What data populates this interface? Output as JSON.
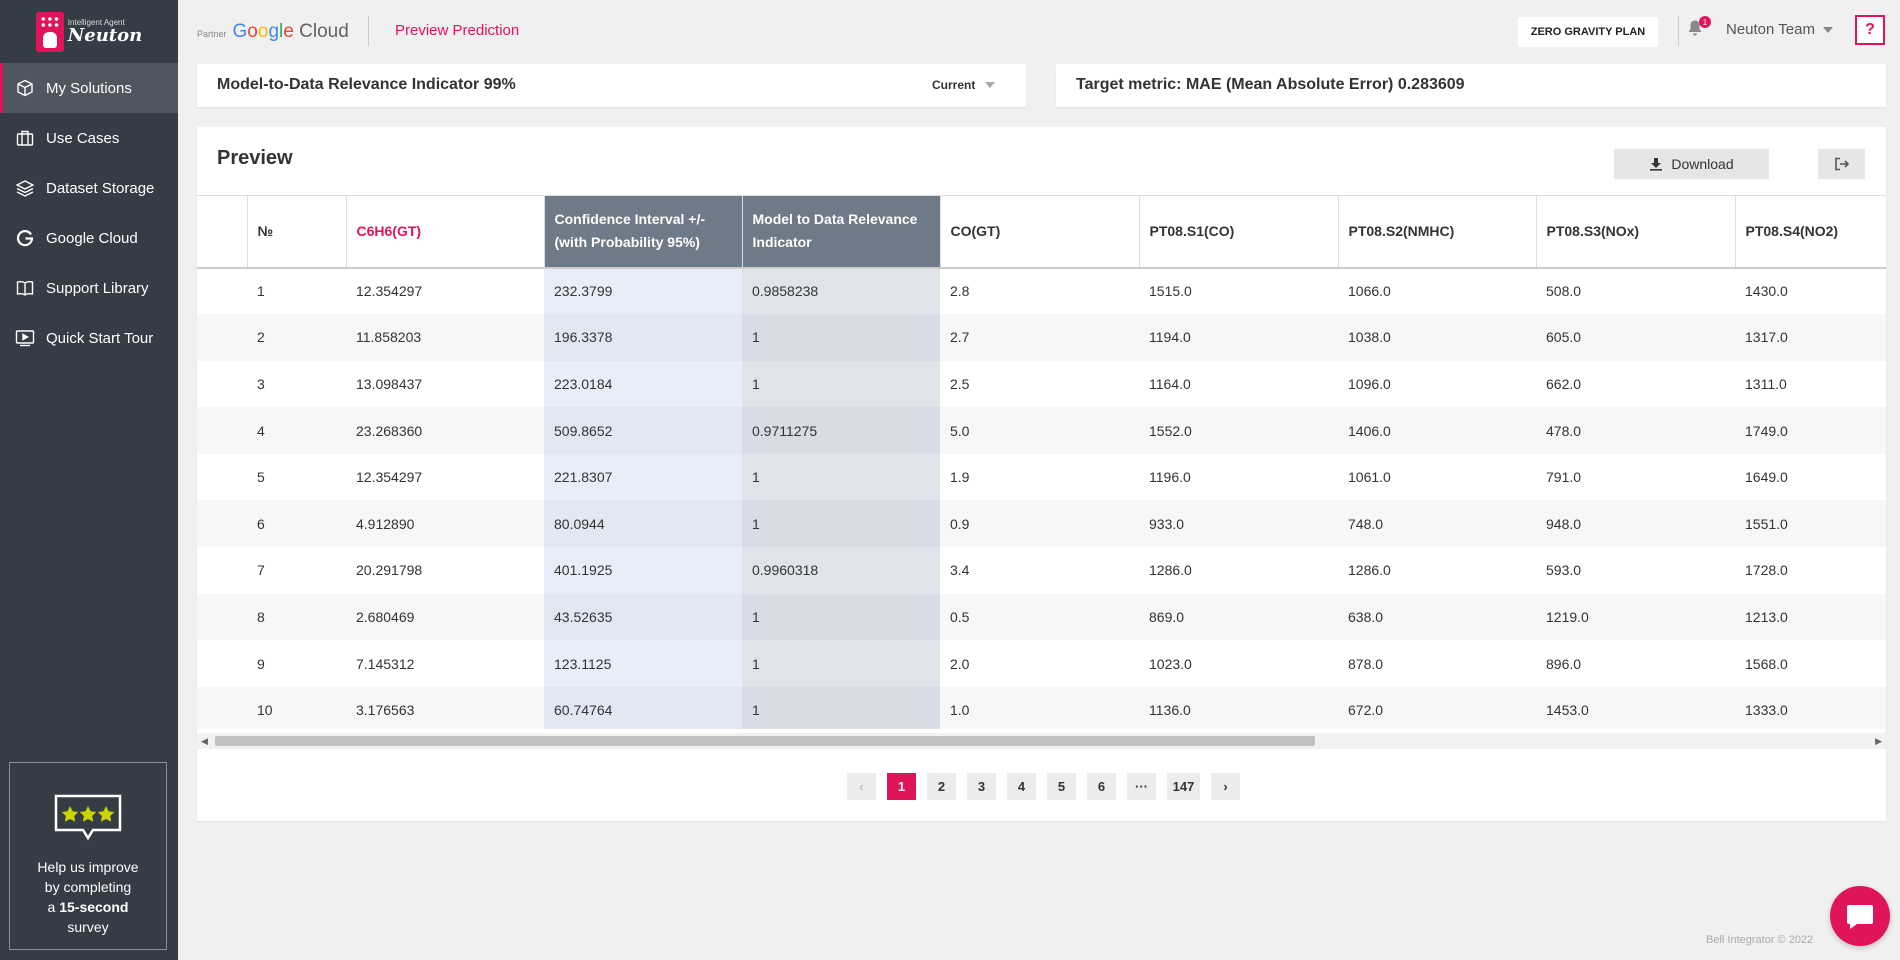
{
  "app": {
    "logo_sub": "Intelligent Agent",
    "logo_name": "Neuton"
  },
  "sidebar": {
    "items": [
      {
        "label": "My Solutions",
        "icon": "cube-icon",
        "active": true
      },
      {
        "label": "Use Cases",
        "icon": "briefcase-icon"
      },
      {
        "label": "Dataset Storage",
        "icon": "layers-icon"
      },
      {
        "label": "Google Cloud",
        "icon": "google-g-icon"
      },
      {
        "label": "Support Library",
        "icon": "book-icon"
      },
      {
        "label": "Quick Start Tour",
        "icon": "video-icon"
      }
    ],
    "survey": {
      "line1": "Help us improve",
      "line2": "by completing",
      "line3_pre": "a",
      "line3_bold": "15-second",
      "line4": "survey"
    }
  },
  "topbar": {
    "partner_label": "Partner",
    "google_cloud": "Google Cloud",
    "breadcrumb": "Preview Prediction",
    "plan_label": "ZERO GRAVITY PLAN",
    "notification_count": "1",
    "team_label": "Neuton Team",
    "help_label": "?"
  },
  "metrics": {
    "relevance_label": "Model-to-Data Relevance Indicator 99%",
    "relevance_select": "Current",
    "target_label": "Target metric: MAE (Mean Absolute Error) 0.283609"
  },
  "preview": {
    "title": "Preview",
    "download_label": "Download",
    "columns": [
      "",
      "№",
      "C6H6(GT)",
      "Confidence Interval +/- (with Probability 95%)",
      "Model to Data Relevance Indicator",
      "CO(GT)",
      "PT08.S1(CO)",
      "PT08.S2(NMHC)",
      "PT08.S3(NOx)",
      "PT08.S4(NO2)"
    ],
    "rows": [
      [
        "",
        "1",
        "12.354297",
        "232.3799",
        "0.9858238",
        "2.8",
        "1515.0",
        "1066.0",
        "508.0",
        "1430.0"
      ],
      [
        "",
        "2",
        "11.858203",
        "196.3378",
        "1",
        "2.7",
        "1194.0",
        "1038.0",
        "605.0",
        "1317.0"
      ],
      [
        "",
        "3",
        "13.098437",
        "223.0184",
        "1",
        "2.5",
        "1164.0",
        "1096.0",
        "662.0",
        "1311.0"
      ],
      [
        "",
        "4",
        "23.268360",
        "509.8652",
        "0.9711275",
        "5.0",
        "1552.0",
        "1406.0",
        "478.0",
        "1749.0"
      ],
      [
        "",
        "5",
        "12.354297",
        "221.8307",
        "1",
        "1.9",
        "1196.0",
        "1061.0",
        "791.0",
        "1649.0"
      ],
      [
        "",
        "6",
        "4.912890",
        "80.0944",
        "1",
        "0.9",
        "933.0",
        "748.0",
        "948.0",
        "1551.0"
      ],
      [
        "",
        "7",
        "20.291798",
        "401.1925",
        "0.9960318",
        "3.4",
        "1286.0",
        "1286.0",
        "593.0",
        "1728.0"
      ],
      [
        "",
        "8",
        "2.680469",
        "43.52635",
        "1",
        "0.5",
        "869.0",
        "638.0",
        "1219.0",
        "1213.0"
      ],
      [
        "",
        "9",
        "7.145312",
        "123.1125",
        "1",
        "2.0",
        "1023.0",
        "878.0",
        "896.0",
        "1568.0"
      ],
      [
        "",
        "10",
        "3.176563",
        "60.74764",
        "1",
        "1.0",
        "1136.0",
        "672.0",
        "1453.0",
        "1333.0"
      ]
    ],
    "pagination": {
      "prev": "‹",
      "pages": [
        "1",
        "2",
        "3",
        "4",
        "5",
        "6",
        "···",
        "147"
      ],
      "next": "›",
      "current": "1"
    }
  },
  "footer": "Bell Integrator © 2022",
  "colors": {
    "accent": "#e0145a",
    "sidebar": "#353c46",
    "header_highlight": "#6e7a88"
  }
}
